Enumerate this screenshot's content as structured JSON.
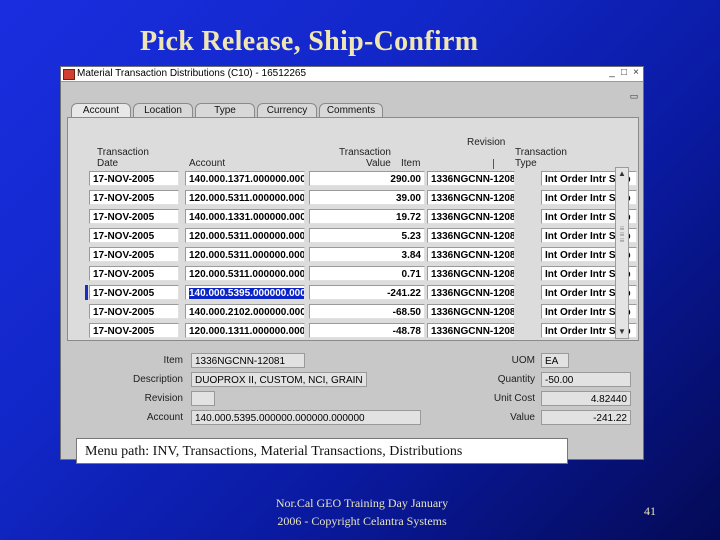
{
  "slide": {
    "title": "Pick Release, Ship-Confirm",
    "caption": "Menu path: INV, Transactions, Material Transactions, Distributions",
    "footer_line1": "Nor.Cal GEO Training Day January",
    "footer_line2": "2006 - Copyright Celantra Systems",
    "page_number": "41"
  },
  "window": {
    "title": "Material Transaction Distributions (C10) - 16512265"
  },
  "tabs": [
    "Account",
    "Location",
    "Type",
    "Currency",
    "Comments"
  ],
  "table": {
    "headers": {
      "date_1": "Transaction",
      "date_2": "Date",
      "account": "Account",
      "value_1": "Transaction",
      "value_2": "Value",
      "revision": "Revision",
      "item": "Item",
      "type_1": "Transaction",
      "type_2": "Type"
    },
    "rows": [
      {
        "date": "17-NOV-2005",
        "account": "140.000.1371.000000.000",
        "value": "290.00",
        "item": "1336NGCNN-1208",
        "type": "Int Order Intr Ship"
      },
      {
        "date": "17-NOV-2005",
        "account": "120.000.5311.000000.000",
        "value": "39.00",
        "item": "1336NGCNN-1208",
        "type": "Int Order Intr Ship"
      },
      {
        "date": "17-NOV-2005",
        "account": "140.000.1331.000000.000",
        "value": "19.72",
        "item": "1336NGCNN-1208",
        "type": "Int Order Intr Ship"
      },
      {
        "date": "17-NOV-2005",
        "account": "120.000.5311.000000.000",
        "value": "5.23",
        "item": "1336NGCNN-1208",
        "type": "Int Order Intr Ship"
      },
      {
        "date": "17-NOV-2005",
        "account": "120.000.5311.000000.000",
        "value": "3.84",
        "item": "1336NGCNN-1208",
        "type": "Int Order Intr Ship"
      },
      {
        "date": "17-NOV-2005",
        "account": "120.000.5311.000000.000",
        "value": "0.71",
        "item": "1336NGCNN-1208",
        "type": "Int Order Intr Ship"
      },
      {
        "date": "17-NOV-2005",
        "account": "140.000.5395.000000.000",
        "value": "-241.22",
        "item": "1336NGCNN-1208",
        "type": "Int Order Intr Ship"
      },
      {
        "date": "17-NOV-2005",
        "account": "140.000.2102.000000.000",
        "value": "-68.50",
        "item": "1336NGCNN-1208",
        "type": "Int Order Intr Ship"
      },
      {
        "date": "17-NOV-2005",
        "account": "120.000.1311.000000.000",
        "value": "-48.78",
        "item": "1336NGCNN-1208",
        "type": "Int Order Intr Ship"
      }
    ]
  },
  "details": {
    "item_label": "Item",
    "item_value": "1336NGCNN-12081",
    "description_label": "Description",
    "description_value": "DUOPROX II, CUSTOM, NCI, GRAIN",
    "revision_label": "Revision",
    "revision_value": "",
    "account_label": "Account",
    "account_value": "140.000.5395.000000.000000.000000",
    "uom_label": "UOM",
    "uom_value": "EA",
    "quantity_label": "Quantity",
    "quantity_value": "-50.00",
    "unit_cost_label": "Unit Cost",
    "unit_cost_value": "4.82440",
    "value_label": "Value",
    "value_value": "-241.22"
  },
  "icons": {
    "minimize": "_",
    "maximize": "□",
    "close": "×",
    "restore": "▭",
    "scroll_up": "▲",
    "scroll_down": "▼"
  }
}
